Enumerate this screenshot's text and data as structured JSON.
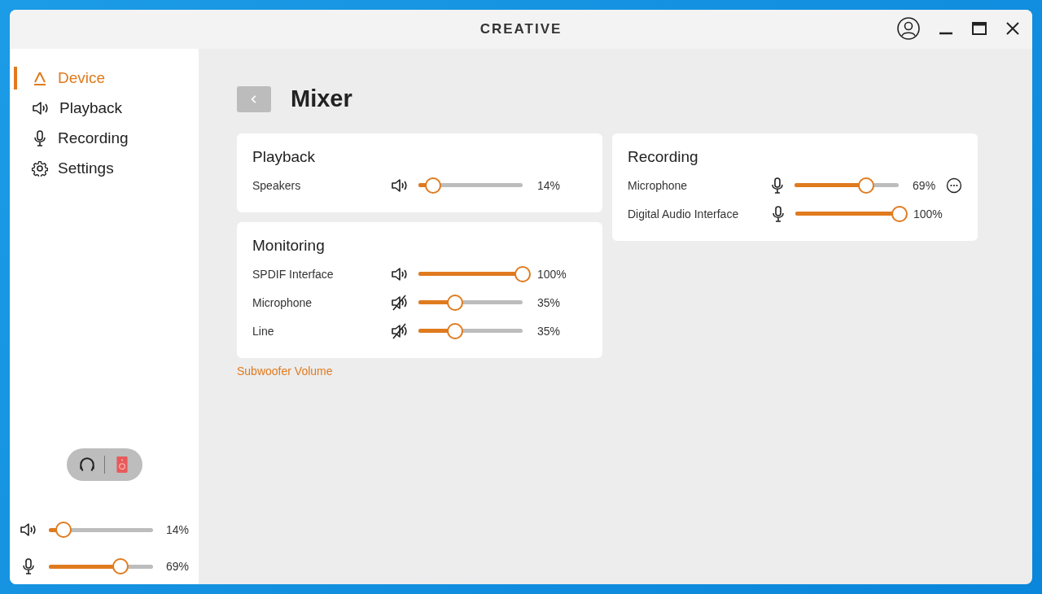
{
  "window": {
    "title": "CREATIVE"
  },
  "sidebar": {
    "items": [
      {
        "label": "Device",
        "kind": "device",
        "selected": true
      },
      {
        "label": "Playback",
        "kind": "speaker",
        "selected": false
      },
      {
        "label": "Recording",
        "kind": "mic",
        "selected": false
      },
      {
        "label": "Settings",
        "kind": "gear",
        "selected": false
      }
    ],
    "output_switch": [
      {
        "kind": "headphones",
        "selected": false
      },
      {
        "kind": "speaker",
        "selected": true
      }
    ],
    "quick_sliders": [
      {
        "kind": "speaker",
        "level": 0.14,
        "reading": "14%"
      },
      {
        "kind": "mic",
        "level": 0.69,
        "reading": "69%"
      }
    ]
  },
  "page": {
    "title": "Mixer",
    "left_cards": [
      {
        "title": "Playback",
        "rows": [
          {
            "name": "Speakers",
            "kind": "speaker",
            "level": 0.14,
            "reading": "14%"
          }
        ]
      },
      {
        "title": "Monitoring",
        "rows": [
          {
            "name": "SPDIF Interface",
            "kind": "speaker",
            "level": 1.0,
            "reading": "100%"
          },
          {
            "name": "Microphone",
            "kind": "muted",
            "level": 0.35,
            "reading": "35%"
          },
          {
            "name": "Line",
            "kind": "muted",
            "level": 0.35,
            "reading": "35%"
          }
        ]
      }
    ],
    "right_cards": [
      {
        "title": "Recording",
        "rows": [
          {
            "name": "Microphone",
            "kind": "mic",
            "level": 0.69,
            "reading": "69%",
            "more": true
          },
          {
            "name": "Digital Audio Interface",
            "kind": "mic",
            "level": 1.0,
            "reading": "100%",
            "more": false
          }
        ]
      }
    ],
    "link": "Subwoofer Volume"
  }
}
